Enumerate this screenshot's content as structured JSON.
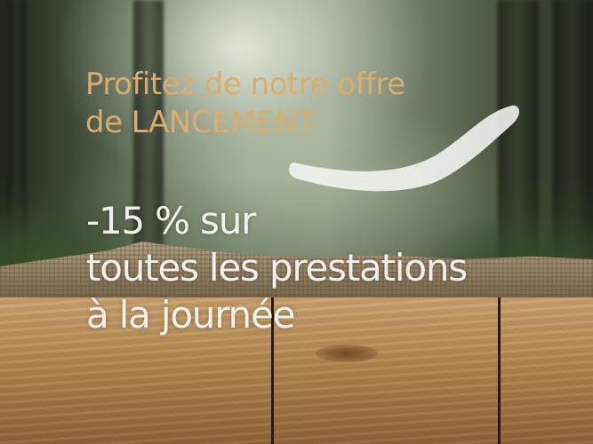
{
  "headline": {
    "line1": "Profitez de notre offre",
    "line2": "de LANCEMENT"
  },
  "offer": {
    "line1": "-15 % sur",
    "line2": "toutes les prestations",
    "line3": "à la journée"
  },
  "colors": {
    "headline": "#d8ae6e",
    "offer": "#f1efea"
  }
}
